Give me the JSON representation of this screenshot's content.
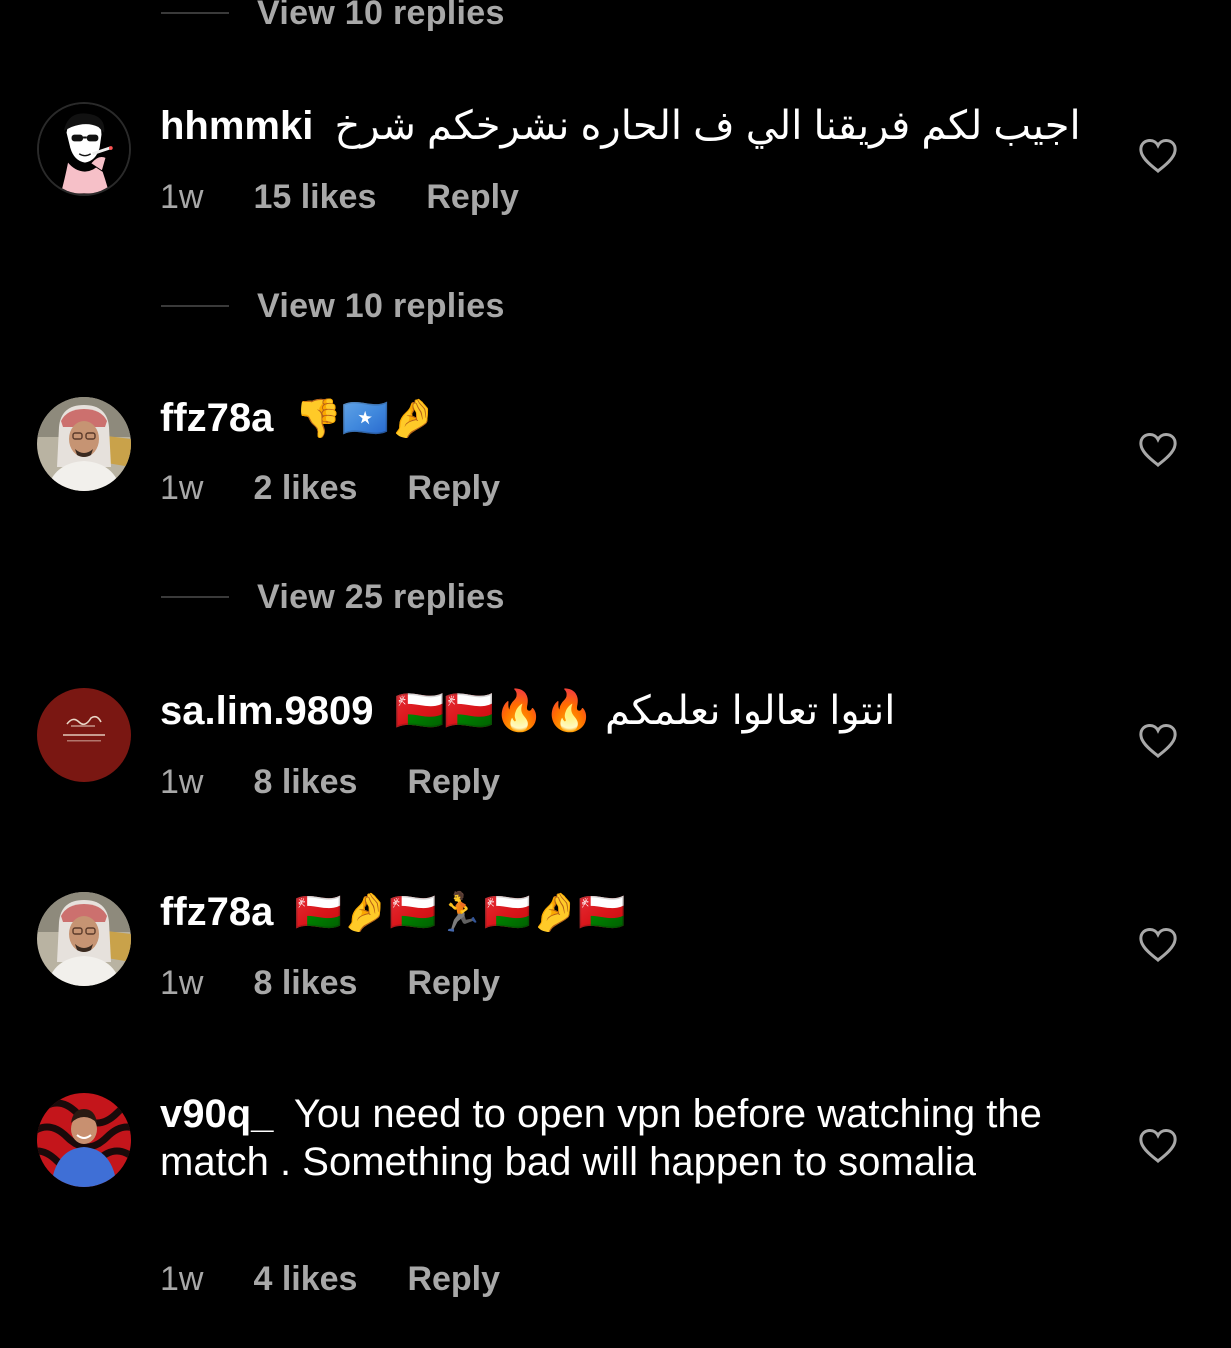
{
  "thread": {
    "top_view_replies": "View 10 replies"
  },
  "comments": [
    {
      "username": "hhmmki",
      "text": "اجيب لكم فريقنا الي ف الحاره نشرخكم شرخ",
      "time": "1w",
      "likes": "15 likes",
      "reply": "Reply",
      "view_replies": "View 10 replies",
      "avatar_icon": "avatar-sketch-smoking-man"
    },
    {
      "username": "ffz78a",
      "text": "👎🇸🇴🤌",
      "time": "1w",
      "likes": "2 likes",
      "reply": "Reply",
      "view_replies": "View 25 replies",
      "avatar_icon": "avatar-photo-man-keffiyeh"
    },
    {
      "username": "sa.lim.9809",
      "text": "انتوا تعالوا نعلمكم 🔥🔥🇴🇲🇴🇲",
      "time": "1w",
      "likes": "8 likes",
      "reply": "Reply",
      "avatar_icon": "avatar-red-calligraphy-badge"
    },
    {
      "username": "ffz78a",
      "text": "🇴🇲🤌🇴🇲🏃🇴🇲🤌🇴🇲",
      "time": "1w",
      "likes": "8 likes",
      "reply": "Reply",
      "avatar_icon": "avatar-photo-man-keffiyeh"
    },
    {
      "username": "v90q_",
      "text": "You need to open vpn before watching the match . Something bad will happen to somalia",
      "time": "1w",
      "likes": "4 likes",
      "reply": "Reply",
      "avatar_icon": "avatar-photo-man-red-swirl"
    }
  ],
  "icons": {
    "like": "heart-outline-icon"
  },
  "colors": {
    "background": "#000000",
    "primary_text": "#ffffff",
    "secondary_text": "#a8a8a8",
    "divider": "#3a3a3a"
  }
}
